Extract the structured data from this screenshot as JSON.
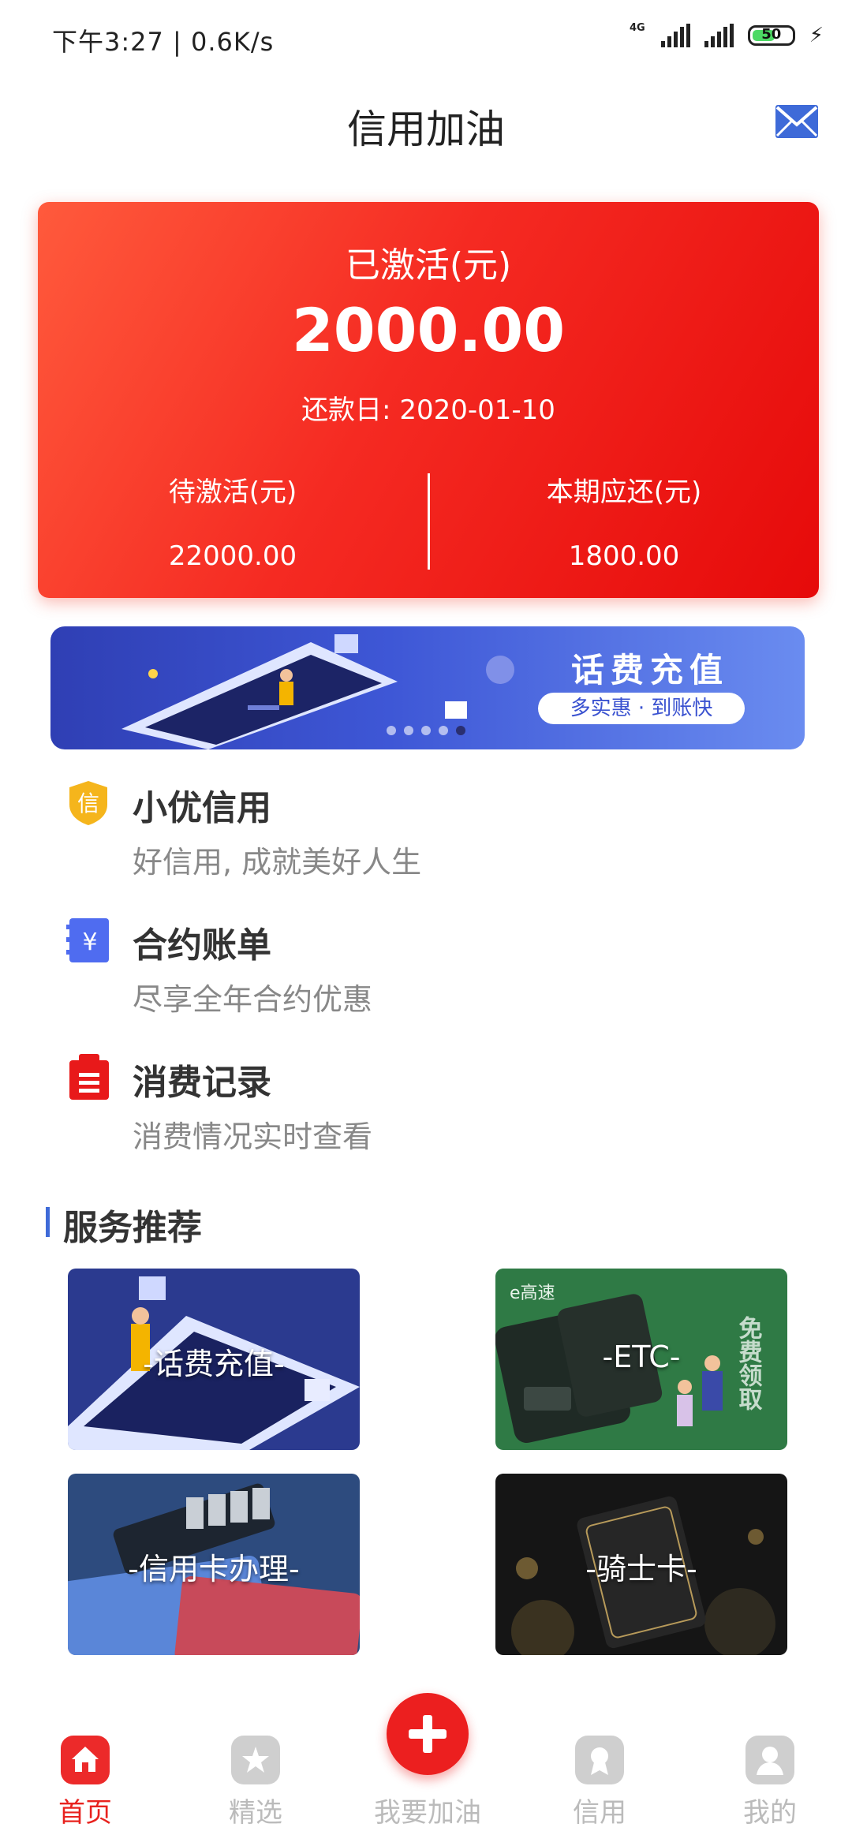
{
  "status_bar": {
    "time": "下午3:27 | 0.6K/s",
    "network": "4G",
    "battery": "50"
  },
  "header": {
    "title": "信用加油",
    "mail_icon": "mail-icon"
  },
  "balance_card": {
    "activated_label": "已激活(元)",
    "activated_amount": "2000.00",
    "repay_date": "还款日: 2020-01-10",
    "pending_label": "待激活(元)",
    "pending_amount": "22000.00",
    "due_label": "本期应还(元)",
    "due_amount": "1800.00"
  },
  "banner": {
    "title": "话费充值",
    "subtitle": "多实惠 · 到账快",
    "dots_total": 5,
    "active_dot": 5
  },
  "menu": [
    {
      "icon": "shield-credit-icon",
      "icon_char": "信",
      "title": "小优信用",
      "subtitle": "好信用, 成就美好人生"
    },
    {
      "icon": "yuan-bill-icon",
      "icon_char": "¥",
      "title": "合约账单",
      "subtitle": "尽享全年合约优惠"
    },
    {
      "icon": "record-list-icon",
      "icon_char": "",
      "title": "消费记录",
      "subtitle": "消费情况实时查看"
    }
  ],
  "section": {
    "title": "服务推荐"
  },
  "services": [
    {
      "label": "-话费充值-"
    },
    {
      "label": "-ETC-",
      "watermark": "e高速",
      "side_text": "免费领取"
    },
    {
      "label": "-信用卡办理-"
    },
    {
      "label": "-骑士卡-"
    }
  ],
  "bottom_nav": {
    "items": [
      {
        "label": "首页",
        "icon": "home-icon"
      },
      {
        "label": "精选",
        "icon": "featured-icon"
      },
      {
        "label": "我要加油",
        "icon": "plus-icon"
      },
      {
        "label": "信用",
        "icon": "credit-badge-icon"
      },
      {
        "label": "我的",
        "icon": "profile-icon"
      }
    ]
  },
  "colors": {
    "brand_red": "#ec1f1f",
    "card_gradient_start": "#ff5a3c",
    "card_gradient_end": "#e60a0a",
    "banner_blue": "#3e57d6",
    "accent_blue": "#3e6ad8"
  }
}
